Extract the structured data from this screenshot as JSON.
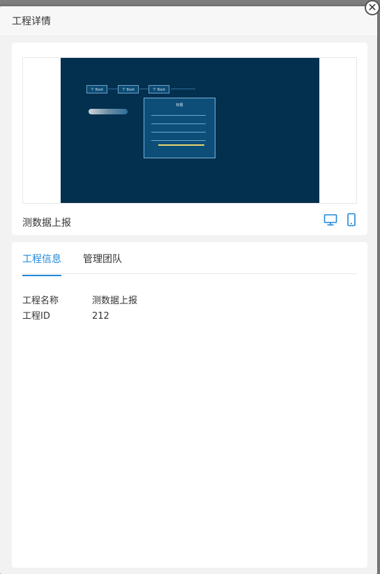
{
  "dialog": {
    "title": "工程详情",
    "close_icon": "✕"
  },
  "preview": {
    "project_name": "测数据上报",
    "thumbnail": {
      "tabs": [
        "个 Boot",
        "个 Boot",
        "个 Boot"
      ],
      "panel_title": "标题"
    },
    "device_icons": [
      "desktop-icon",
      "mobile-icon"
    ]
  },
  "tabs": [
    {
      "label": "工程信息",
      "active": true
    },
    {
      "label": "管理团队",
      "active": false
    }
  ],
  "info": {
    "name_label": "工程名称",
    "name_value": "测数据上报",
    "id_label": "工程ID",
    "id_value": "212"
  },
  "colors": {
    "accent": "#1e87d8",
    "thumbnail_bg": "#03304f"
  }
}
